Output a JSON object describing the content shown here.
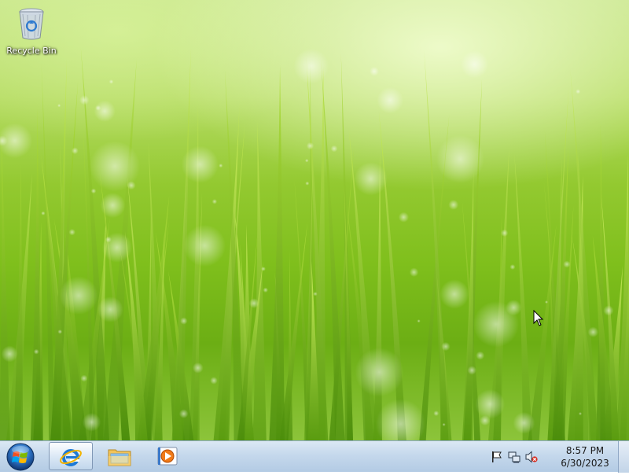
{
  "desktop": {
    "icons": [
      {
        "label": "Recycle Bin",
        "icon": "recycle-bin-icon"
      }
    ]
  },
  "taskbar": {
    "start_button": {
      "icon": "windows-start-orb-icon"
    },
    "pinned": [
      {
        "icon": "internet-explorer-icon",
        "active": true
      },
      {
        "icon": "file-explorer-folder-icon",
        "active": false
      },
      {
        "icon": "media-player-icon",
        "active": false
      }
    ],
    "tray": {
      "icons": [
        "action-center-flag-icon",
        "network-icon",
        "volume-muted-icon"
      ],
      "time": "8:57 PM",
      "date": "6/30/2023"
    }
  }
}
